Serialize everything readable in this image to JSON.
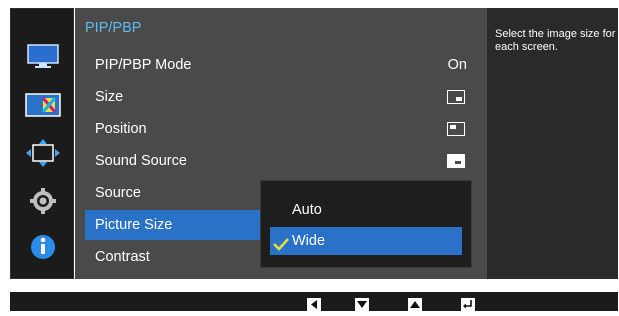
{
  "menu": {
    "title": "PIP/PBP",
    "items": [
      {
        "label": "PIP/PBP Mode",
        "value": "On"
      },
      {
        "label": "Size",
        "icon": "size-icon"
      },
      {
        "label": "Position",
        "icon": "position-icon"
      },
      {
        "label": "Sound Source",
        "icon": "sound-source-icon"
      },
      {
        "label": "Source"
      },
      {
        "label": "Picture Size",
        "selected": true
      },
      {
        "label": "Contrast"
      }
    ]
  },
  "dropdown": {
    "options": [
      {
        "label": "Auto",
        "selected": false
      },
      {
        "label": "Wide",
        "selected": true
      }
    ]
  },
  "help": {
    "text": "Select the image size for each screen."
  },
  "sidebar": {
    "icons": [
      "monitor-icon",
      "color-icon",
      "size-position-icon",
      "settings-icon",
      "information-icon"
    ]
  },
  "bottom_bar": {
    "buttons": [
      "left-arrow-icon",
      "down-arrow-icon",
      "up-arrow-icon",
      "enter-icon"
    ]
  },
  "colors": {
    "accent": "#2a72c8",
    "title": "#61b9ef",
    "checkmark": "#e6e23b"
  }
}
